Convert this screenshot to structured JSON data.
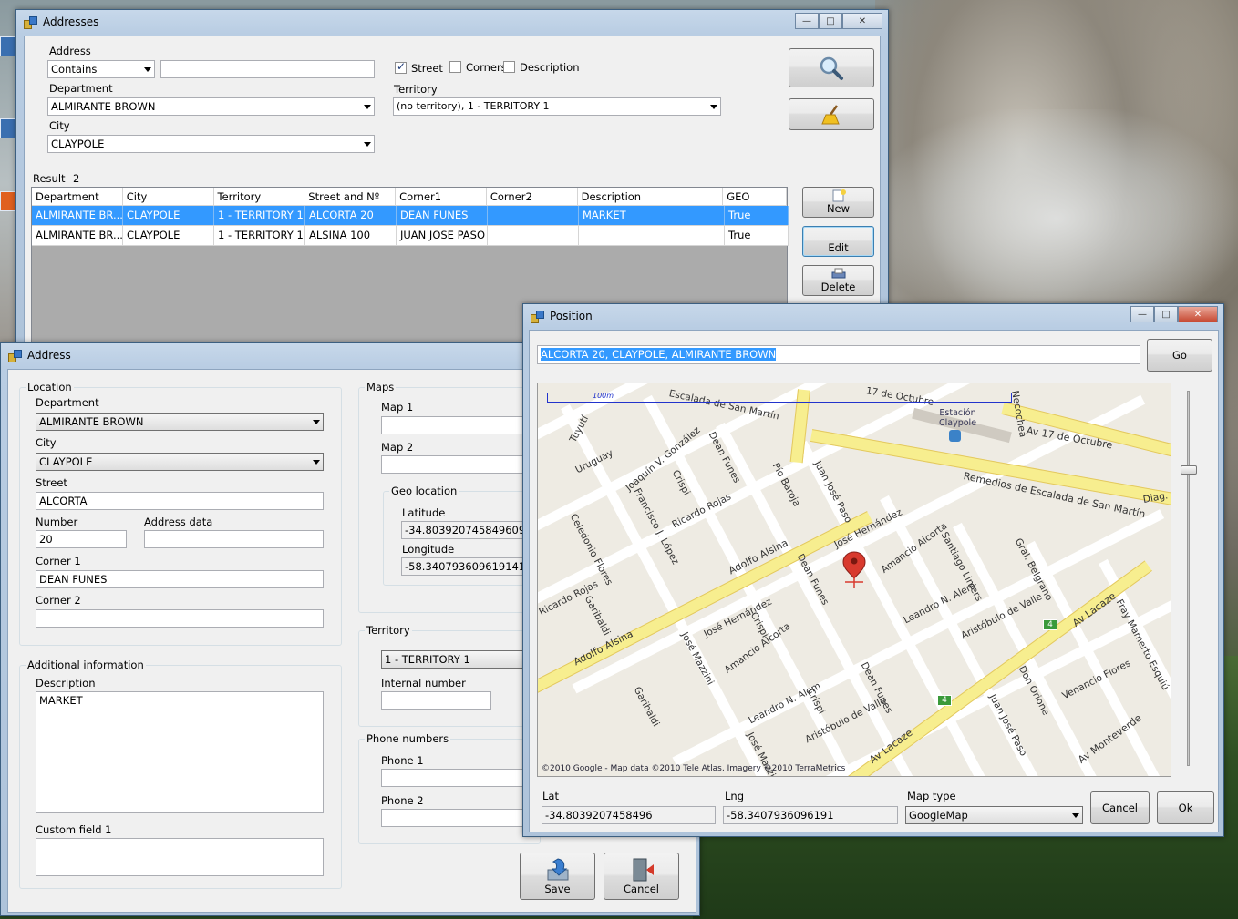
{
  "addresses": {
    "title": "Addresses",
    "address_label": "Address",
    "address_match": "Contains",
    "address_value": "",
    "street_label": "Street",
    "street_checked": true,
    "corners_label": "Corners",
    "description_label": "Description",
    "department_label": "Department",
    "department_value": "ALMIRANTE BROWN",
    "territory_label": "Territory",
    "territory_value": "(no territory), 1 - TERRITORY 1",
    "city_label": "City",
    "city_value": "CLAYPOLE",
    "result_label": "Result",
    "result_count": "2",
    "new_label": "New",
    "edit_label": "Edit",
    "delete_label": "Delete",
    "columns": [
      "Department",
      "City",
      "Territory",
      "Street and Nº",
      "Corner1",
      "Corner2",
      "Description",
      "GEO"
    ],
    "rows": [
      [
        "ALMIRANTE BR...",
        "CLAYPOLE",
        "1 - TERRITORY 1",
        "ALCORTA 20",
        "DEAN FUNES",
        "",
        "MARKET",
        "True"
      ],
      [
        "ALMIRANTE BR...",
        "CLAYPOLE",
        "1 - TERRITORY 1",
        "ALSINA 100",
        "JUAN JOSE PASO",
        "",
        "",
        "True"
      ]
    ]
  },
  "address": {
    "title": "Address",
    "location_label": "Location",
    "department_label": "Department",
    "department_value": "ALMIRANTE BROWN",
    "city_label": "City",
    "city_value": "CLAYPOLE",
    "street_label": "Street",
    "street_value": "ALCORTA",
    "number_label": "Number",
    "number_value": "20",
    "address_data_label": "Address data",
    "address_data_value": "",
    "corner1_label": "Corner 1",
    "corner1_value": "DEAN FUNES",
    "corner2_label": "Corner 2",
    "corner2_value": "",
    "additional_label": "Additional information",
    "description_label": "Description",
    "description_value": "MARKET",
    "custom_label": "Custom field 1",
    "custom_value": "",
    "maps_label": "Maps",
    "map1_label": "Map 1",
    "map2_label": "Map 2",
    "geo_label": "Geo location",
    "lat_label": "Latitude",
    "lat_value": "-34.803920745849609",
    "lng_label": "Longitude",
    "lng_value": "-58.340793609619141",
    "territory_label": "Territory",
    "territory_value": "1 - TERRITORY 1",
    "internal_label": "Internal number",
    "phones_label": "Phone numbers",
    "phone1_label": "Phone 1",
    "phone2_label": "Phone 2",
    "save_label": "Save",
    "cancel_label": "Cancel"
  },
  "position": {
    "title": "Position",
    "search_value": "ALCORTA 20, CLAYPOLE, ALMIRANTE BROWN",
    "go_label": "Go",
    "lat_label": "Lat",
    "lat_value": "-34.8039207458496",
    "lng_label": "Lng",
    "lng_value": "-58.3407936096191",
    "maptype_label": "Map type",
    "maptype_value": "GoogleMap",
    "cancel_label": "Cancel",
    "ok_label": "Ok",
    "zoom_level": 0.2,
    "map": {
      "copyright": "©2010 Google - Map data ©2010 Tele Atlas, Imagery ©2010 TerraMetrics",
      "scale_label": "100m",
      "station": "Estación\nClaypole",
      "route_badge": "4",
      "streets": [
        "Adolfo Alsina",
        "Av 17 de Octubre",
        "Remedios de Escalada de San Martín",
        "Av Lacaze",
        "Av Monteverde",
        "Juan José Paso",
        "Dean Funes",
        "José Hernández",
        "Amancio Alcorta",
        "Leandro N. Alem",
        "Aristóbulo de Valle",
        "Santiago Liniers",
        "Gral. Belgrano",
        "Don Orione",
        "Venancio Flores",
        "Fray Mamerto Esquiú",
        "Crispi",
        "Ricardo Rojas",
        "Francisco J. López",
        "Joaquín V. González",
        "Uruguay",
        "Tuyutí",
        "Celedonio Flores",
        "Garibaldi",
        "José Mazzini",
        "Pío Baroja",
        "Necochea",
        "Diag.",
        "Escalada de San Martín",
        "17 de Octubre"
      ]
    }
  },
  "colors": {
    "selection": "#3399ff",
    "title_bar": "#b9cde3",
    "road_major": "#f7ee8f"
  }
}
